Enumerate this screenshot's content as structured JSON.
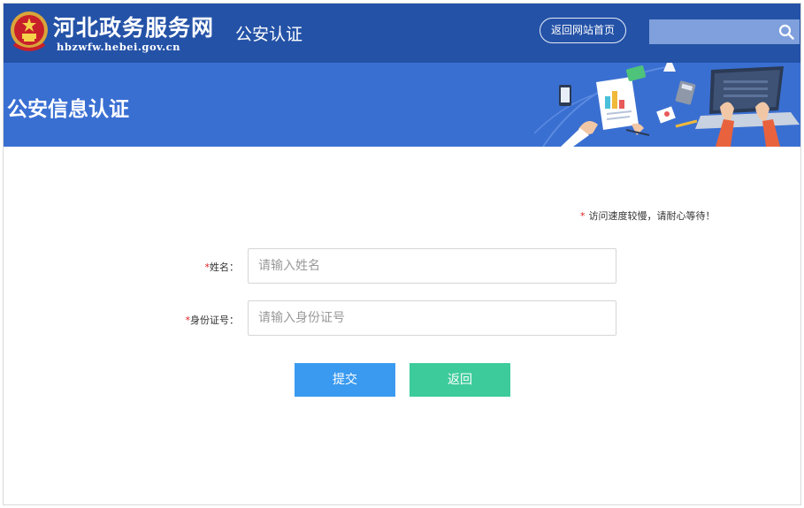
{
  "header": {
    "site_name": "河北政务服务网",
    "site_url": "hbzwfw.hebei.gov.cn",
    "section_title": "公安认证",
    "home_link": "返回网站首页",
    "search_placeholder": "",
    "search_icon": "search-icon",
    "emblem_icon": "national-emblem-icon"
  },
  "banner": {
    "title": "公安信息认证"
  },
  "notice": {
    "star": "*",
    "text": "访问速度较慢，请耐心等待！"
  },
  "form": {
    "name_label_star": "*",
    "name_label": "姓名：",
    "name_placeholder": "请输入姓名",
    "name_value": "",
    "id_label_star": "*",
    "id_label": "身份证号：",
    "id_placeholder": "请输入身份证号",
    "id_value": ""
  },
  "buttons": {
    "submit": "提交",
    "back": "返回"
  },
  "colors": {
    "header_bg": "#2452a7",
    "banner_bg": "#3a6fd2",
    "submit_bg": "#3a9af0",
    "back_bg": "#3dcb9b",
    "required_star": "#e02020"
  }
}
